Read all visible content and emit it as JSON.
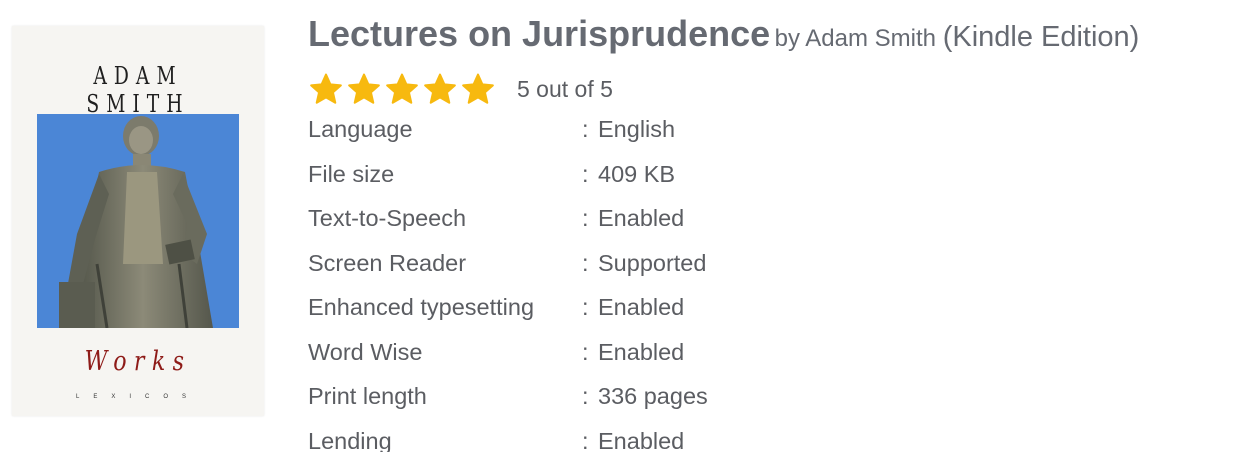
{
  "cover": {
    "author": "ADAM SMITH",
    "series": "Works",
    "publisher": "LEXICOS",
    "sky_color": "#4b86d6"
  },
  "book": {
    "title": "Lectures on Jurisprudence",
    "by_label": "by",
    "author": "Adam Smith",
    "edition": "(Kindle Edition)"
  },
  "rating": {
    "stars": 5,
    "max": 5,
    "text": "5 out of 5",
    "star_color": "#f7b90f"
  },
  "specs": [
    {
      "label": "Language",
      "sep": ":",
      "value": "English"
    },
    {
      "label": "File size",
      "sep": ":",
      "value": "409 KB"
    },
    {
      "label": "Text-to-Speech",
      "sep": ":",
      "value": "Enabled"
    },
    {
      "label": "Screen Reader",
      "sep": ":",
      "value": "Supported"
    },
    {
      "label": "Enhanced typesetting",
      "sep": ":",
      "value": "Enabled"
    },
    {
      "label": "Word Wise",
      "sep": ":",
      "value": "Enabled"
    },
    {
      "label": "Print length",
      "sep": ":",
      "value": "336 pages"
    },
    {
      "label": "Lending",
      "sep": ":",
      "value": "Enabled"
    }
  ]
}
